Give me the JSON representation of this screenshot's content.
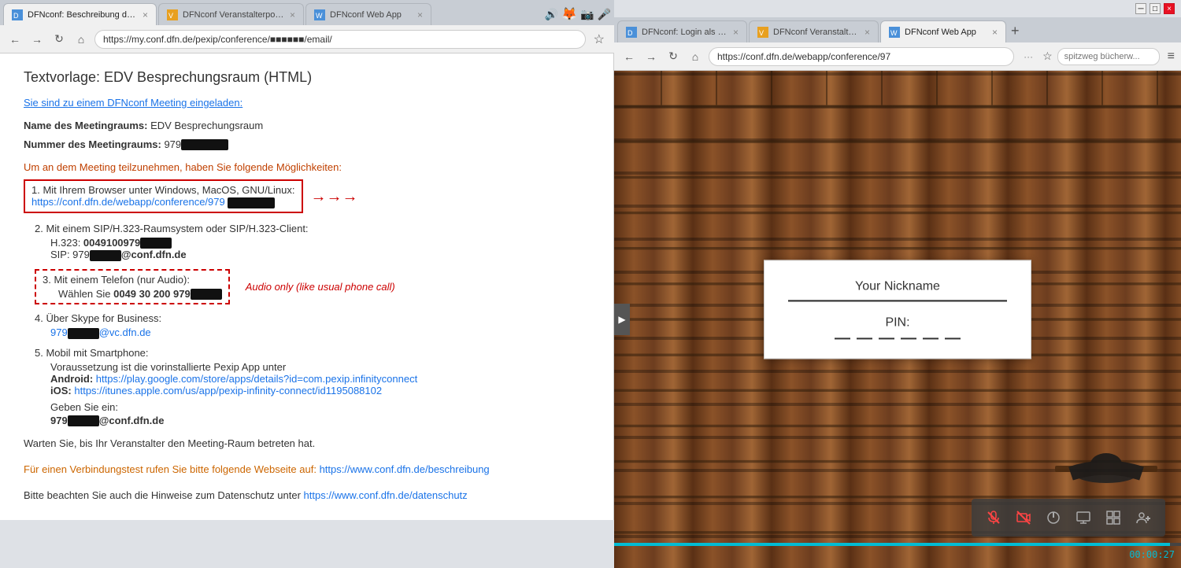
{
  "left_browser": {
    "tabs": [
      {
        "label": "DFNconf: Beschreibung des Dienst...",
        "active": true
      },
      {
        "label": "DFNconf Veranstalterportal",
        "active": false
      },
      {
        "label": "DFNconf Web App",
        "active": false
      }
    ],
    "address": "https://my.conf.dfn.de/pexip/conference/■■■■■■/email/",
    "page": {
      "title": "Textvorlage: EDV Besprechungsraum (HTML)",
      "invite_link_text": "Sie sind zu einem DFNconf Meeting eingeladen:",
      "meeting_name_label": "Name des Meetingraums:",
      "meeting_name_value": "EDV Besprechungsraum",
      "meeting_number_label": "Nummer des Meetingraums:",
      "meeting_number_value": "979",
      "participation_intro": "Um an dem Meeting teilzunehmen, haben Sie folgende Möglichkeiten:",
      "options": [
        {
          "num": "1.",
          "title": "Mit Ihrem Browser unter Windows, MacOS, GNU/Linux:",
          "link": "https://conf.dfn.de/webapp/conference/979",
          "link_display": "https://conf.dfn.de/webapp/conference/979",
          "has_red_box": true
        },
        {
          "num": "2.",
          "title": "Mit einem SIP/H.323-Raumsystem oder SIP/H.323-Client:",
          "details": [
            {
              "label": "H.323:",
              "value": "0049100979"
            },
            {
              "label": "SIP:",
              "value": "979■■■■@conf.dfn.de"
            }
          ]
        },
        {
          "num": "3.",
          "title": "Mit einem Telefon (nur Audio):",
          "details": [
            {
              "label": "Wählen Sie",
              "value": "0049 30 200 979"
            }
          ],
          "audio_label": "Audio only (like usual phone call)",
          "has_red_dashed_box": true
        },
        {
          "num": "4.",
          "title": "Über Skype for Business:",
          "details": [
            {
              "label": "",
              "value": "979■■■■@vc.dfn.de"
            }
          ]
        },
        {
          "num": "5.",
          "title": "Mobil mit Smartphone:",
          "subtitle": "Voraussetzung ist die vorinstallierte Pexip App unter",
          "android_label": "Android:",
          "android_link": "https://play.google.com/store/apps/details?id=com.pexip.infinityconnect",
          "ios_label": "iOS:",
          "ios_link": "https://itunes.apple.com/us/app/pexip-infinity-connect/id1195088102",
          "enter_label": "Geben Sie ein:",
          "enter_value": "979■■■■@conf.dfn.de"
        }
      ],
      "footer1": "Warten Sie, bis Ihr Veranstalter den Meeting-Raum betreten hat.",
      "footer2": "Für einen Verbindungstest rufen Sie bitte folgende Webseite auf:",
      "footer2_link": "https://www.conf.dfn.de/beschreibung",
      "footer3": "Bitte beachten Sie auch die Hinweise zum Datenschutz unter",
      "footer3_link": "https://www.conf.dfn.de/datenschutz"
    }
  },
  "right_browser": {
    "tabs": [
      {
        "label": "DFNconf: Login als Meetingverans...",
        "active": false
      },
      {
        "label": "DFNconf Veranstalterportal",
        "active": false
      },
      {
        "label": "DFNconf Web App",
        "active": true
      }
    ],
    "address": "https://conf.dfn.de/webapp/conference/97",
    "search_placeholder": "spitzweg bücherw...",
    "conference": {
      "login_modal": {
        "nickname_label": "Your Nickname",
        "pin_label": "PIN:"
      },
      "timer": "00:00:27",
      "controls": [
        "mic-off",
        "camera-off",
        "power",
        "screen-share",
        "layout",
        "add-participant"
      ]
    }
  }
}
